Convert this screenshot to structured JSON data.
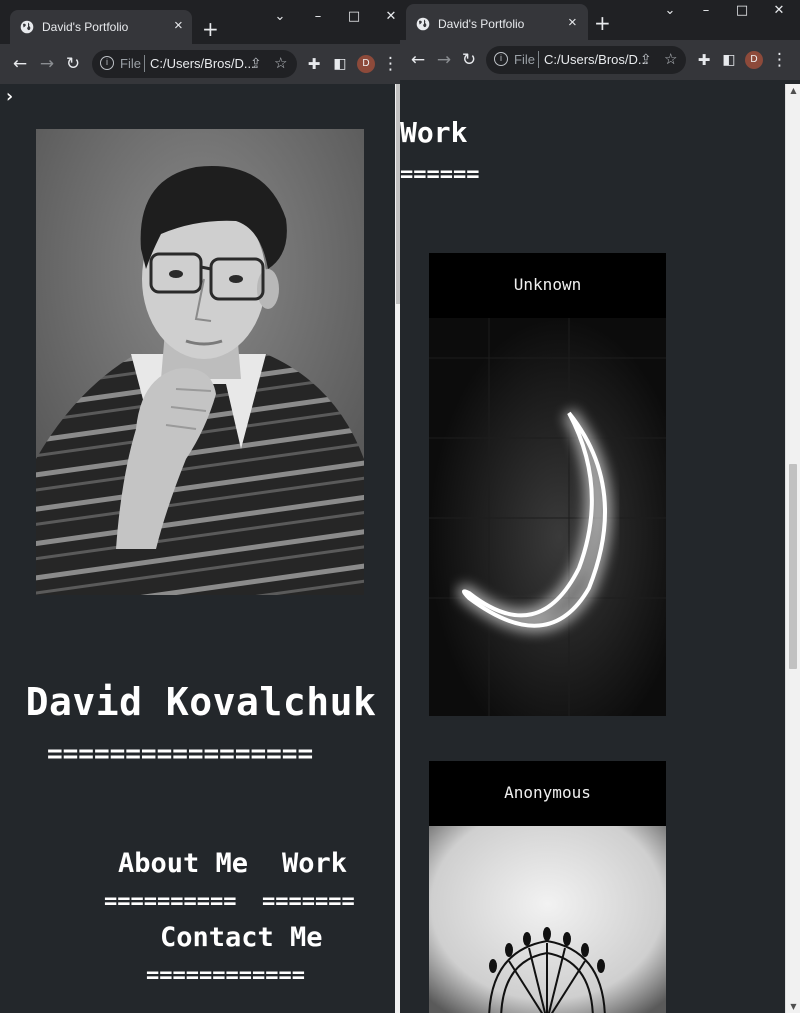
{
  "left_window": {
    "tab": {
      "title": "David's Portfolio",
      "close": "×",
      "favicon": "globe-icon"
    },
    "new_tab": "+",
    "window_controls": {
      "minimize": "–",
      "maximize": "□",
      "close": "✕",
      "tab_search": "⌄"
    },
    "omnibox": {
      "security_label": "File",
      "url": "C:/Users/Bros/D..."
    },
    "profile_initial": "D",
    "page": {
      "menu_toggle": "›",
      "name": "David Kovalchuk",
      "name_underline": "=================",
      "nav": [
        {
          "label": "About Me",
          "underline": "=========="
        },
        {
          "label": "Work",
          "underline": "======="
        },
        {
          "label": "Contact Me",
          "underline": "============"
        }
      ]
    }
  },
  "right_window": {
    "tab": {
      "title": "David's Portfolio",
      "close": "×",
      "favicon": "globe-icon"
    },
    "new_tab": "+",
    "window_controls": {
      "minimize": "–",
      "maximize": "□",
      "close": "✕",
      "tab_search": "⌄"
    },
    "omnibox": {
      "security_label": "File",
      "url": "C:/Users/Bros/D..."
    },
    "profile_initial": "D",
    "page": {
      "section_title": "Work",
      "section_underline": "======",
      "cards": [
        {
          "title": "Unknown"
        },
        {
          "title": "Anonymous"
        }
      ]
    }
  },
  "colors": {
    "page_background": "#23272b",
    "browser_frame": "#202124",
    "toolbar": "#35363a",
    "text": "#ffffff"
  }
}
